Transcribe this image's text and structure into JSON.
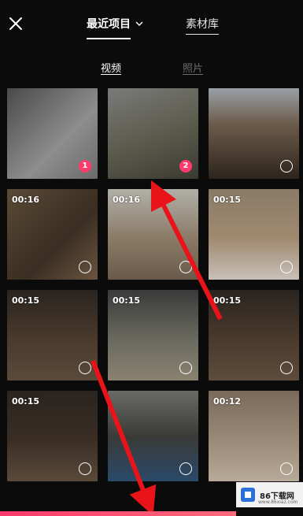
{
  "header": {
    "recent_label": "最近项目",
    "library_label": "素材库"
  },
  "subtabs": {
    "video_label": "视频",
    "photo_label": "照片"
  },
  "grid": {
    "items": [
      {
        "duration": "",
        "selected_index": "1"
      },
      {
        "duration": "",
        "selected_index": "2"
      },
      {
        "duration": "",
        "selected_index": ""
      },
      {
        "duration": "00:16",
        "selected_index": ""
      },
      {
        "duration": "00:16",
        "selected_index": ""
      },
      {
        "duration": "00:15",
        "selected_index": ""
      },
      {
        "duration": "00:15",
        "selected_index": ""
      },
      {
        "duration": "00:15",
        "selected_index": ""
      },
      {
        "duration": "00:15",
        "selected_index": ""
      },
      {
        "duration": "00:15",
        "selected_index": ""
      },
      {
        "duration": "",
        "selected_index": ""
      },
      {
        "duration": "00:12",
        "selected_index": ""
      }
    ]
  },
  "watermark": {
    "site_name": "86下载网",
    "site_url": "www.86xiaz.com"
  },
  "colors": {
    "accent": "#ff3a6d",
    "annotation_arrow": "#e8141a",
    "background": "#0b0b0b"
  },
  "icons": [
    "close-icon",
    "chevron-down-icon",
    "selection-circle-icon"
  ]
}
